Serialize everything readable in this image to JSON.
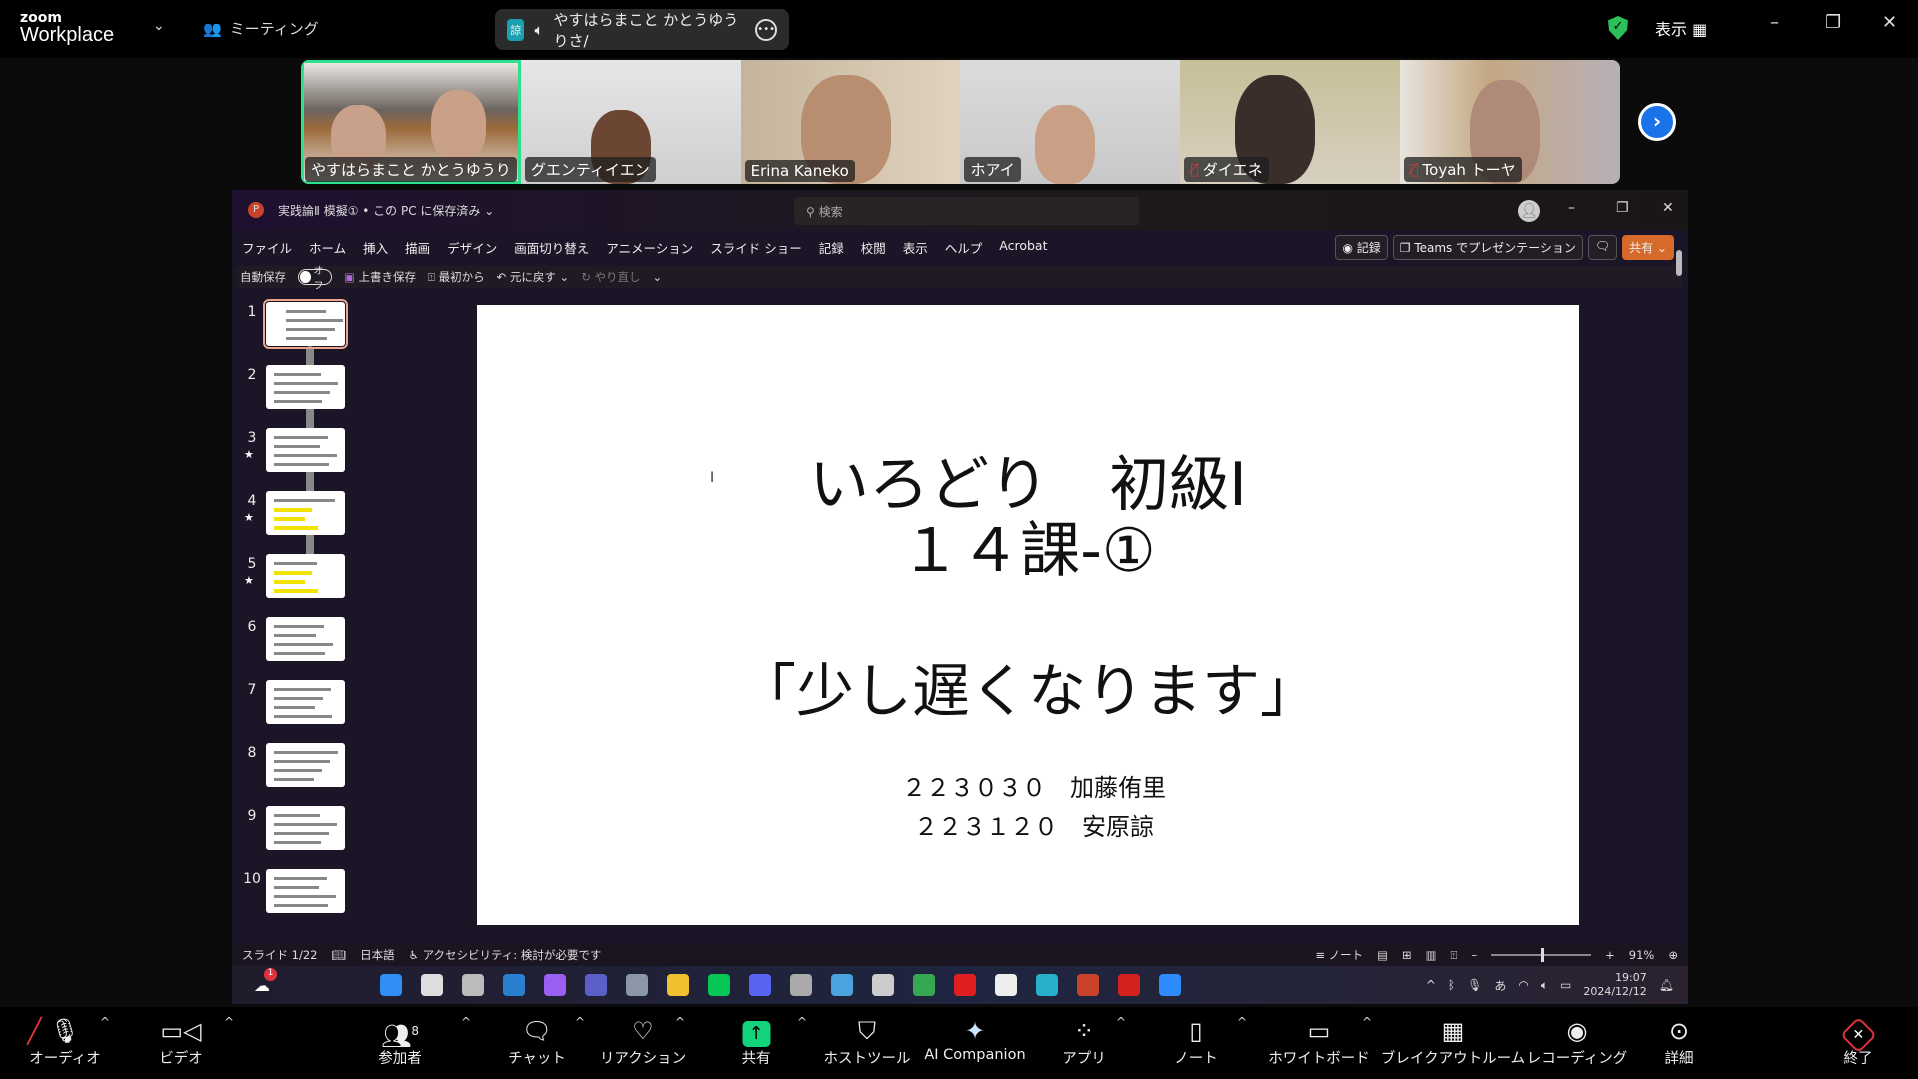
{
  "zoom": {
    "brand_small": "zoom",
    "brand": "Workplace",
    "meeting_label": "ミーティング",
    "caption_badge": "諒",
    "speaker_text": "やすはらまこと かとうゆうりさ/",
    "view_label": "表示"
  },
  "participants": [
    {
      "name": "やすはらまこと かとうゆうり",
      "muted": false,
      "active": true
    },
    {
      "name": "グエンティイエン",
      "muted": false,
      "active": false
    },
    {
      "name": "Erina Kaneko",
      "muted": false,
      "active": false
    },
    {
      "name": "ホアイ",
      "muted": false,
      "active": false
    },
    {
      "name": "ダイエネ",
      "muted": true,
      "active": false
    },
    {
      "name": "Toyah トーヤ",
      "muted": true,
      "active": false
    }
  ],
  "ppt": {
    "title": "実践論Ⅱ 模擬① • この PC に保存済み ⌄",
    "search_placeholder": "検索",
    "menu": [
      "ファイル",
      "ホーム",
      "挿入",
      "描画",
      "デザイン",
      "画面切り替え",
      "アニメーション",
      "スライド ショー",
      "記録",
      "校閲",
      "表示",
      "ヘルプ",
      "Acrobat"
    ],
    "record_btn": "◉ 記録",
    "teams_btn": "Teams でプレゼンテーション",
    "share_btn": "共有",
    "qat": {
      "autosave": "自動保存",
      "autosave_state": "オフ",
      "save": "上書き保存",
      "from_start": "最初から",
      "undo": "元に戻す",
      "redo": "やり直し"
    },
    "thumbs": [
      {
        "n": "1",
        "star": false
      },
      {
        "n": "2",
        "star": false
      },
      {
        "n": "3",
        "star": true
      },
      {
        "n": "4",
        "star": true
      },
      {
        "n": "5",
        "star": true
      },
      {
        "n": "6",
        "star": false
      },
      {
        "n": "7",
        "star": false
      },
      {
        "n": "8",
        "star": false
      },
      {
        "n": "9",
        "star": false
      },
      {
        "n": "10",
        "star": false
      }
    ],
    "slide": {
      "line1": "いろどり　初級Ⅰ",
      "line2": "１４課-①",
      "line3": "「少し遅くなります」",
      "author1": "２２３０３０　加藤侑里",
      "author2": "２２３１２０　安原諒"
    },
    "status": {
      "slide": "スライド 1/22",
      "lang": "日本語",
      "accessibility": "アクセシビリティ: 検討が必要です",
      "notes": "ノート",
      "zoom": "91%",
      "zoom_level": 91
    }
  },
  "taskbar": {
    "weather_badge": "1",
    "time": "19:07",
    "date": "2024/12/12",
    "ime": "あ",
    "icons": [
      {
        "name": "windows-start",
        "color": "#2f8ff5"
      },
      {
        "name": "search",
        "color": "#ddd"
      },
      {
        "name": "task-view",
        "color": "#bbb"
      },
      {
        "name": "edge",
        "color": "#2a7fd0"
      },
      {
        "name": "copilot",
        "color": "#9a5ff0"
      },
      {
        "name": "teams",
        "color": "#5b5fc7"
      },
      {
        "name": "settings",
        "color": "#8a97a8"
      },
      {
        "name": "file-explorer",
        "color": "#f0c030"
      },
      {
        "name": "line",
        "color": "#06c755"
      },
      {
        "name": "discord",
        "color": "#5865f2"
      },
      {
        "name": "app-swirl",
        "color": "#aaa"
      },
      {
        "name": "notepad",
        "color": "#4aa3df"
      },
      {
        "name": "qr-app",
        "color": "#ccc"
      },
      {
        "name": "chrome",
        "color": "#34a853"
      },
      {
        "name": "video-app",
        "color": "#e02020"
      },
      {
        "name": "kindle-app",
        "color": "#eee"
      },
      {
        "name": "cc-app",
        "color": "#27b0c9"
      },
      {
        "name": "powerpoint",
        "color": "#c9432a"
      },
      {
        "name": "acrobat",
        "color": "#d4221e"
      },
      {
        "name": "zoom",
        "color": "#2d8cff"
      }
    ]
  },
  "toolbar": {
    "audio": "オーディオ",
    "video": "ビデオ",
    "participants": "参加者",
    "participant_count": "8",
    "chat": "チャット",
    "reactions": "リアクション",
    "share": "共有",
    "host_tools": "ホストツール",
    "ai": "AI Companion",
    "apps": "アプリ",
    "notes": "ノート",
    "whiteboard": "ホワイトボード",
    "breakout": "ブレイクアウトルーム",
    "recording": "レコーディング",
    "more": "詳細",
    "end": "終了"
  },
  "colors": {
    "active_speaker": "#2de08e",
    "share_green": "#12d37c",
    "end_red": "#e0323c",
    "ppt_share": "#d66a2b"
  }
}
